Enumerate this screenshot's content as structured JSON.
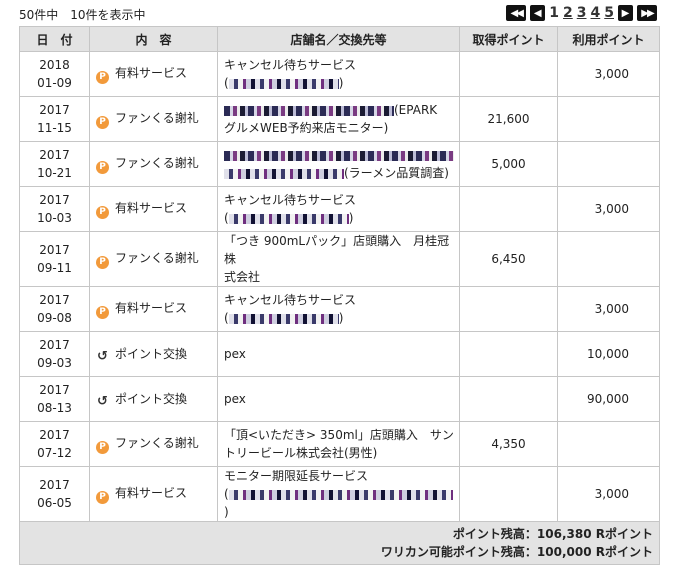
{
  "header": {
    "count_text": "50件中　10件を表示中"
  },
  "pager": {
    "first_icon": "double-chevron-left-icon",
    "prev_icon": "chevron-left-icon",
    "pages": [
      "1",
      "2",
      "3",
      "4",
      "5"
    ],
    "current_page": "1",
    "next_icon": "chevron-right-icon",
    "last_icon": "double-chevron-right-icon"
  },
  "table": {
    "columns": [
      "日　付",
      "内　容",
      "店舗名／交換先等",
      "取得ポイント",
      "利用ポイント"
    ],
    "rows": [
      {
        "year": "2018",
        "date": "01-09",
        "icon": "coin-icon",
        "type": "有料サービス",
        "store_l1": "キャンセル待ちサービス",
        "store_l2_prefix": "(",
        "store_l2_suffix": ")",
        "earned": "",
        "used": "3,000"
      },
      {
        "year": "2017",
        "date": "11-15",
        "icon": "coin-icon",
        "type": "ファンくる謝礼",
        "store_l1": "(EPARK",
        "store_l2_prefix": "グルメWEB予約来店モニター)",
        "store_l2_suffix": "",
        "earned": "21,600",
        "used": ""
      },
      {
        "year": "2017",
        "date": "10-21",
        "icon": "coin-icon",
        "type": "ファンくる謝礼",
        "store_l1": "",
        "store_l2_prefix": "(ラーメン品質調査)",
        "store_l2_suffix": "",
        "earned": "5,000",
        "used": ""
      },
      {
        "year": "2017",
        "date": "10-03",
        "icon": "coin-icon",
        "type": "有料サービス",
        "store_l1": "キャンセル待ちサービス",
        "store_l2_prefix": "(",
        "store_l2_suffix": ")",
        "earned": "",
        "used": "3,000"
      },
      {
        "year": "2017",
        "date": "09-11",
        "icon": "coin-icon",
        "type": "ファンくる謝礼",
        "store_l1": "「つき 900mLパック」店頭購入　月桂冠株",
        "store_l2_prefix": "式会社",
        "store_l2_suffix": "",
        "earned": "6,450",
        "used": ""
      },
      {
        "year": "2017",
        "date": "09-08",
        "icon": "coin-icon",
        "type": "有料サービス",
        "store_l1": "キャンセル待ちサービス",
        "store_l2_prefix": "(",
        "store_l2_suffix": ")",
        "earned": "",
        "used": "3,000"
      },
      {
        "year": "2017",
        "date": "09-03",
        "icon": "exchange-icon",
        "type": "ポイント交換",
        "store_l1": "pex",
        "store_l2_prefix": "",
        "store_l2_suffix": "",
        "earned": "",
        "used": "10,000"
      },
      {
        "year": "2017",
        "date": "08-13",
        "icon": "exchange-icon",
        "type": "ポイント交換",
        "store_l1": "pex",
        "store_l2_prefix": "",
        "store_l2_suffix": "",
        "earned": "",
        "used": "90,000"
      },
      {
        "year": "2017",
        "date": "07-12",
        "icon": "coin-icon",
        "type": "ファンくる謝礼",
        "store_l1": "「頂<いただき> 350ml」店頭購入　サン",
        "store_l2_prefix": "トリービール株式会社(男性)",
        "store_l2_suffix": "",
        "earned": "4,350",
        "used": ""
      },
      {
        "year": "2017",
        "date": "06-05",
        "icon": "coin-icon",
        "type": "有料サービス",
        "store_l1": "モニター期限延長サービス",
        "store_l2_prefix": "(",
        "store_l2_suffix": ")",
        "earned": "",
        "used": "3,000"
      }
    ]
  },
  "summary": {
    "balance_label": "ポイント残高：",
    "balance_value": "106,380 Rポイント",
    "warikan_label": "ワリカン可能ポイント残高：",
    "warikan_value": "100,000 Rポイント"
  }
}
